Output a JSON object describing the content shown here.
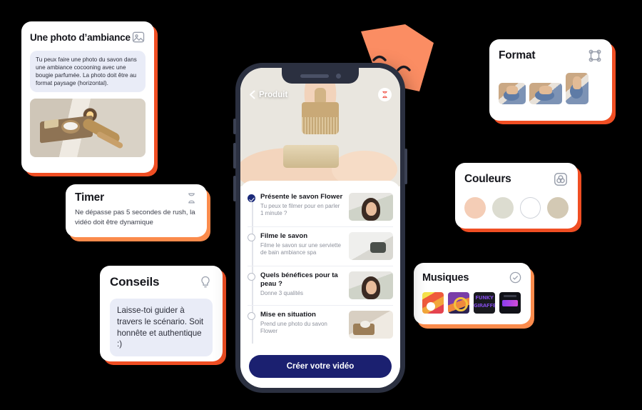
{
  "cards": {
    "photo": {
      "title": "Une photo d’ambiance",
      "icon": "image-icon",
      "body": "Tu peux faire une photo du savon dans une ambiance cocooning avec une bougie parfumée. La photo doit être au format paysage (horizontal).",
      "thumb_alt": "spa-bath-scene"
    },
    "timer": {
      "title": "Timer",
      "icon": "hourglass-icon",
      "body": "Ne dépasse pas 5 secondes de rush, la vidéo doit être dynamique"
    },
    "conseils": {
      "title": "Conseils",
      "icon": "lightbulb-icon",
      "body": "Laisse-toi guider à travers le scénario. Soit honnête et authentique :)"
    },
    "format": {
      "title": "Format",
      "icon": "crop-frame-icon",
      "thumbs": [
        {
          "name": "format-square",
          "alt": "pottery-square"
        },
        {
          "name": "format-landscape",
          "alt": "pottery-landscape"
        },
        {
          "name": "format-portrait",
          "alt": "pottery-portrait"
        }
      ]
    },
    "couleurs": {
      "title": "Couleurs",
      "icon": "color-palette-icon",
      "swatches": [
        {
          "name": "swatch-peach",
          "hex": "#f4cdb6"
        },
        {
          "name": "swatch-sage",
          "hex": "#dcdcd0"
        },
        {
          "name": "swatch-white",
          "hex": "#ffffff"
        },
        {
          "name": "swatch-taupe",
          "hex": "#d3c9b4"
        }
      ]
    },
    "musiques": {
      "title": "Musiques",
      "icon": "check-circle-icon",
      "albums": [
        {
          "name": "album-art-1",
          "alt": "colorful-abstract"
        },
        {
          "name": "album-art-2",
          "alt": "purple-headphones"
        },
        {
          "name": "album-art-3",
          "alt": "funky-giraffe",
          "line1": "FUNKY",
          "line2": "GIRAFFE"
        },
        {
          "name": "album-art-4",
          "alt": "dark-synth"
        }
      ]
    }
  },
  "decor": {
    "mask": {
      "name": "theater-mask",
      "color": "#fb8d63"
    }
  },
  "phone": {
    "header": {
      "back_label": "Produit",
      "back_icon": "chevron-left-icon",
      "timer_icon": "hourglass-icon"
    },
    "hero_alt": "hands-holding-soap-and-brush",
    "tasks": [
      {
        "title": "Présente le savon Flower",
        "subtitle": "Tu peux te filmer pour en parler 1 minute ?",
        "done": true,
        "thumb": "th-woman"
      },
      {
        "title": "Filme le savon",
        "subtitle": "Filme le savon sur une serviette de bain ambiance spa",
        "done": false,
        "thumb": "th-towel"
      },
      {
        "title": "Quels bénéfices pour ta peau ?",
        "subtitle": "Donne 3 qualités",
        "done": false,
        "thumb": "th-woman"
      },
      {
        "title": "Mise en situation",
        "subtitle": "Prend une photo du savon Flower",
        "done": false,
        "thumb": "th-spa"
      }
    ],
    "cta_label": "Créer votre vidéo",
    "cta_color": "#1b2070"
  }
}
